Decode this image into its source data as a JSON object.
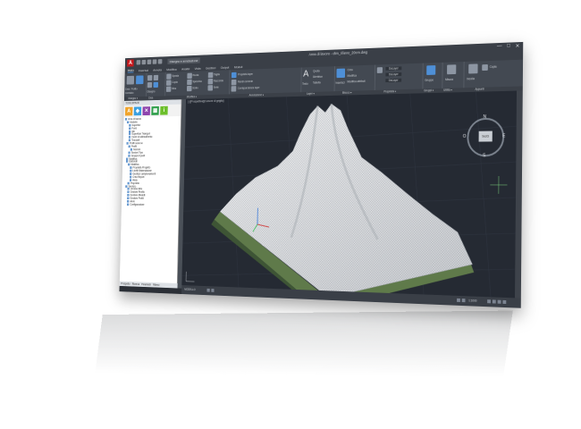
{
  "titlebar": {
    "app_icon": "A",
    "doc_tab": "Disegno e annotazione",
    "title": "Area di lavoro - dtm_rilievo_20cm.dwg",
    "controls": [
      "—",
      "□",
      "✕"
    ]
  },
  "ribbon_tabs": [
    "Inizio",
    "Inserisci",
    "Annota",
    "Modifica",
    "Analisi",
    "Vista",
    "Gestisci",
    "Output",
    "Moduli"
  ],
  "ribbon": {
    "create": [
      "Crea",
      "Profilo",
      "Corridoio"
    ],
    "draw": [
      "Disegno",
      "Polilinea",
      "Traccia"
    ],
    "modify": [
      "Sposta",
      "Ruota",
      "Taglia",
      "Copia",
      "Specchia",
      "Raccorda",
      "Stira",
      "Scala",
      "Serie"
    ],
    "annotation": [
      "Testo",
      "Quota",
      "Direttrice",
      "Tabella"
    ],
    "layers": [
      "Proprietà layer",
      "Rendi corrente",
      "Corrispondenza layer"
    ],
    "block": [
      "Inserisci",
      "Crea",
      "Modifica",
      "Modifica attributi"
    ],
    "properties": [
      "DaLayer",
      "DaLayer",
      "DaLayer"
    ],
    "groups": [
      "Gruppo"
    ],
    "utilities": [
      "Misura"
    ],
    "clipboard": [
      "Incolla",
      "Copia"
    ]
  },
  "panel_labels": [
    "Disegno ▾",
    "Crea",
    "Modifica ▾",
    "Annotazione ▾",
    "Layer ▾",
    "Blocco ▾",
    "Proprietà ▾",
    "Gruppi ▾",
    "Utilità ▾",
    "Appunti"
  ],
  "toolspace": {
    "header": "TOOLSPACE",
    "icons": [
      {
        "glyph": "A",
        "color": "#f0a42b"
      },
      {
        "glyph": "◆",
        "color": "#3aa0e0"
      },
      {
        "glyph": "✕",
        "color": "#8e44ad"
      },
      {
        "glyph": "▦",
        "color": "#2e9e4a"
      },
      {
        "glyph": "i",
        "color": "#6cbf2a"
      }
    ],
    "tree": [
      "Area di lavoro",
      "Modello",
      "Superfici",
      "Punti",
      "Siti",
      "Superficie Triangoli",
      "Centri di allineamento",
      "Tracciati",
      "Profili sezione",
      "Profili",
      "Sezioni",
      "Sezioni Tipo",
      "Gruppi di punti",
      "Modifica",
      "Elaborati",
      "Modifica",
      "Proprietà Progetto",
      "Livelli Sistemazione",
      "Gestisci campionamenti",
      "Crea Report",
      "Aiuto",
      "Proprietà",
      "Servizio",
      "Libreria Stile",
      "Gestore Profilo",
      "Gestore Modelli",
      "Gestore Profili",
      "Aiuto",
      "Configurazione"
    ],
    "tabs": [
      "Prospetto",
      "Ricerca",
      "Parametri",
      "Rilievo"
    ]
  },
  "viewport": {
    "label": "[-][Prospettiva][Cursore di griglia]",
    "compass": {
      "N": "N",
      "S": "S",
      "E": "E",
      "O": "O",
      "center": "SUD"
    }
  },
  "statusbar": {
    "model": "MODELLO",
    "scale": "1:1000",
    "items": [
      "MODELLO",
      "#",
      "1:1000"
    ]
  },
  "colors": {
    "accent": "#4a90d9",
    "viewport_bg": "#252a33",
    "mesh": "#e6e8ea"
  }
}
